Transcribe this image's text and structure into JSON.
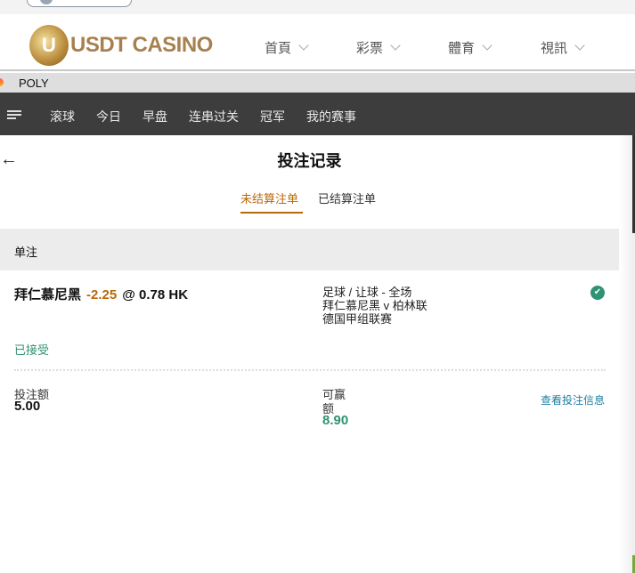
{
  "site": {
    "logo_text": "USDT CASINO",
    "logo_badge": "U",
    "nav": [
      "首頁",
      "彩票",
      "體育",
      "視訊"
    ]
  },
  "provider": {
    "name": "POLY"
  },
  "sports_nav": {
    "items": [
      "滚球",
      "今日",
      "早盘",
      "连串过关",
      "冠军",
      "我的赛事"
    ]
  },
  "page": {
    "title": "投注记录",
    "tabs": [
      {
        "label": "未结算注单",
        "active": true
      },
      {
        "label": "已结算注单",
        "active": false
      }
    ]
  },
  "section": {
    "label": "单注"
  },
  "bet": {
    "selection": "拜仁慕尼黑",
    "handicap": "-2.25",
    "at": "@",
    "odds": "0.78 HK",
    "market": "足球 / 让球 - 全场",
    "match": "拜仁慕尼黑 v 柏林联",
    "league": "德国甲组联赛",
    "status": "已接受",
    "stake_label": "投注额",
    "stake": "5.00",
    "win_label_1": "可赢",
    "win_label_2": "额",
    "win": "8.90",
    "details_link": "查看投注信息"
  },
  "colors": {
    "accent": "#b8690a",
    "success": "#2f9273",
    "link": "#1a7fa0",
    "nav_bg": "#3d3d3d"
  }
}
